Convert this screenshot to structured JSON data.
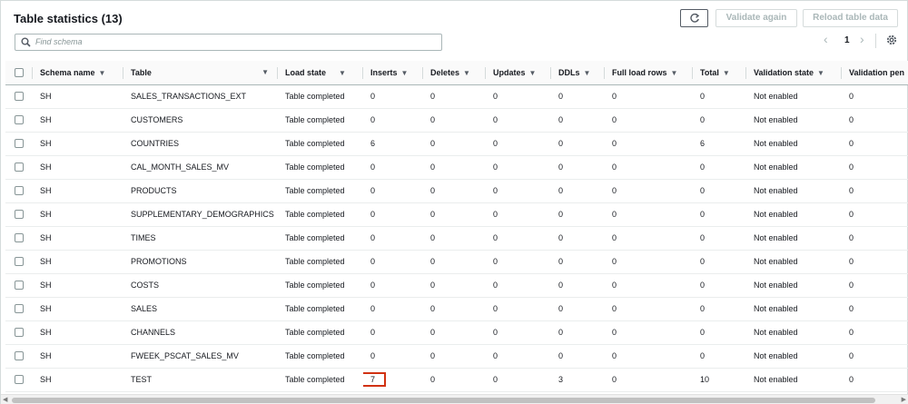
{
  "header": {
    "title": "Table statistics (13)",
    "validate_label": "Validate again",
    "reload_label": "Reload table data"
  },
  "search": {
    "placeholder": "Find schema"
  },
  "pagination": {
    "prev": "‹",
    "current_page": "1",
    "next": "›"
  },
  "columns": [
    "Schema name",
    "Table",
    "Load state",
    "Inserts",
    "Deletes",
    "Updates",
    "DDLs",
    "Full load rows",
    "Total",
    "Validation state",
    "Validation pen"
  ],
  "rows": [
    [
      "SH",
      "SALES_TRANSACTIONS_EXT",
      "Table completed",
      "0",
      "0",
      "0",
      "0",
      "0",
      "0",
      "Not enabled",
      "0"
    ],
    [
      "SH",
      "CUSTOMERS",
      "Table completed",
      "0",
      "0",
      "0",
      "0",
      "0",
      "0",
      "Not enabled",
      "0"
    ],
    [
      "SH",
      "COUNTRIES",
      "Table completed",
      "6",
      "0",
      "0",
      "0",
      "0",
      "6",
      "Not enabled",
      "0"
    ],
    [
      "SH",
      "CAL_MONTH_SALES_MV",
      "Table completed",
      "0",
      "0",
      "0",
      "0",
      "0",
      "0",
      "Not enabled",
      "0"
    ],
    [
      "SH",
      "PRODUCTS",
      "Table completed",
      "0",
      "0",
      "0",
      "0",
      "0",
      "0",
      "Not enabled",
      "0"
    ],
    [
      "SH",
      "SUPPLEMENTARY_DEMOGRAPHICS",
      "Table completed",
      "0",
      "0",
      "0",
      "0",
      "0",
      "0",
      "Not enabled",
      "0"
    ],
    [
      "SH",
      "TIMES",
      "Table completed",
      "0",
      "0",
      "0",
      "0",
      "0",
      "0",
      "Not enabled",
      "0"
    ],
    [
      "SH",
      "PROMOTIONS",
      "Table completed",
      "0",
      "0",
      "0",
      "0",
      "0",
      "0",
      "Not enabled",
      "0"
    ],
    [
      "SH",
      "COSTS",
      "Table completed",
      "0",
      "0",
      "0",
      "0",
      "0",
      "0",
      "Not enabled",
      "0"
    ],
    [
      "SH",
      "SALES",
      "Table completed",
      "0",
      "0",
      "0",
      "0",
      "0",
      "0",
      "Not enabled",
      "0"
    ],
    [
      "SH",
      "CHANNELS",
      "Table completed",
      "0",
      "0",
      "0",
      "0",
      "0",
      "0",
      "Not enabled",
      "0"
    ],
    [
      "SH",
      "FWEEK_PSCAT_SALES_MV",
      "Table completed",
      "0",
      "0",
      "0",
      "0",
      "0",
      "0",
      "Not enabled",
      "0"
    ],
    [
      "SH",
      "TEST",
      "Table completed",
      "7",
      "0",
      "0",
      "3",
      "0",
      "10",
      "Not enabled",
      "0"
    ]
  ],
  "highlight": {
    "row": 12,
    "col": 3,
    "color": "#d13212"
  },
  "icons": {
    "refresh": "refresh-icon",
    "search": "search-icon",
    "settings": "gear-icon"
  }
}
